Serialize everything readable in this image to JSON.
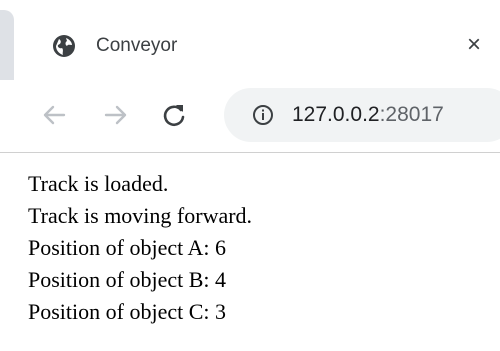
{
  "tab": {
    "title": "Conveyor",
    "favicon_icon": "globe-icon",
    "close_icon": "close-icon",
    "close_glyph": "×"
  },
  "toolbar": {
    "back_icon": "back-arrow-icon",
    "forward_icon": "forward-arrow-icon",
    "reload_icon": "reload-icon",
    "info_icon": "info-icon",
    "url_host": "127.0.0.2",
    "url_port": ":28017"
  },
  "content": {
    "lines": [
      "Track is loaded.",
      "Track is moving forward.",
      "Position of object A: 6",
      "Position of object B: 4",
      "Position of object C: 3"
    ]
  },
  "colors": {
    "tab_strip_edge": "#dee1e6",
    "omnibox_bg": "#f1f3f4",
    "icon_gray": "#5f6368",
    "inactive_arrow": "#bdc1c6",
    "text_dark": "#202124"
  }
}
